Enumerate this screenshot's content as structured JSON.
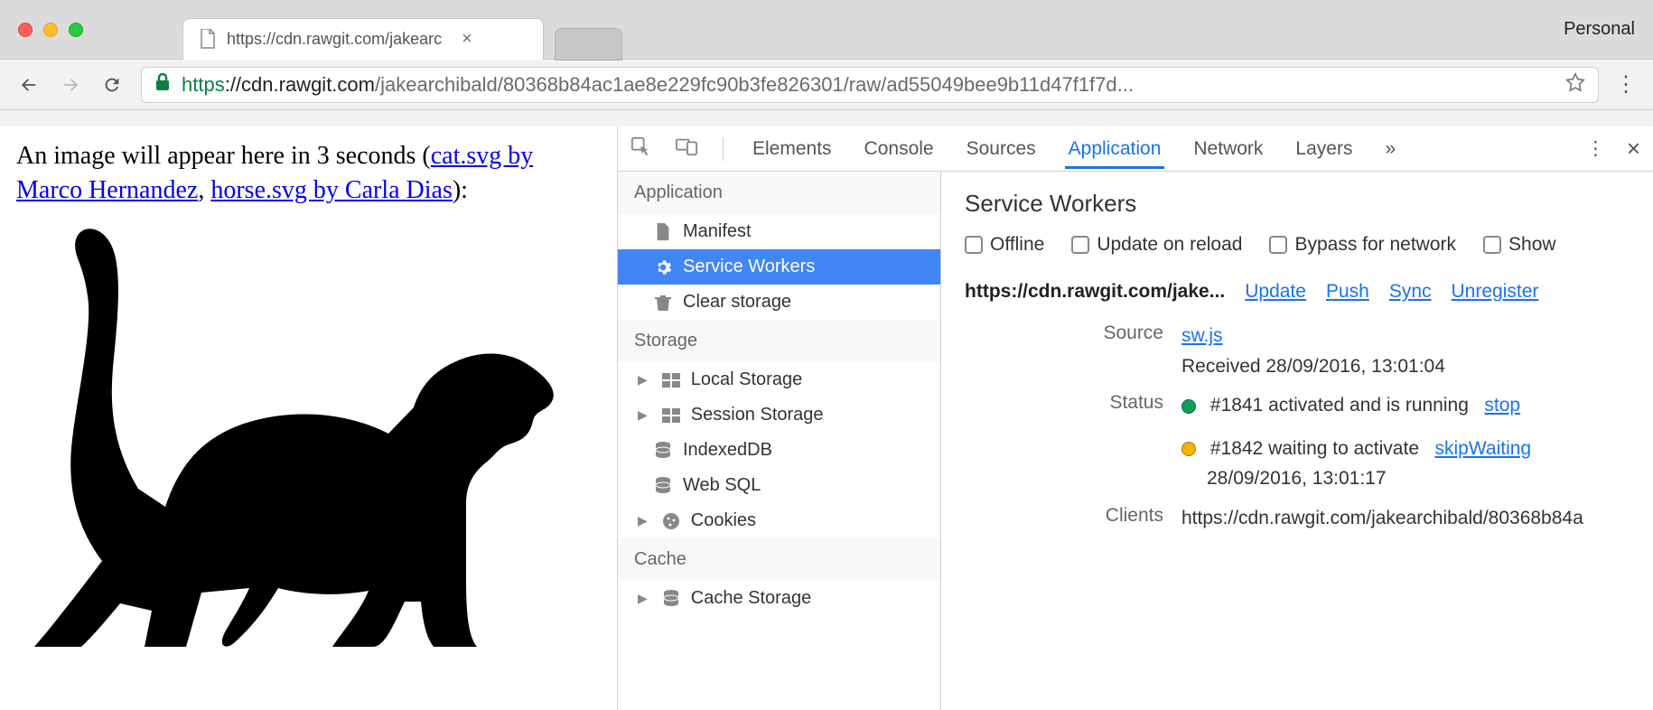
{
  "browser": {
    "tab_url_short": "https://cdn.rawgit.com/jakearc",
    "profile": "Personal",
    "url_scheme": "https",
    "url_host": "://cdn.rawgit.com",
    "url_path": "/jakearchibald/80368b84ac1ae8e229fc90b3fe826301/raw/ad55049bee9b11d47f1f7d..."
  },
  "page": {
    "text_prefix": "An image will appear here in 3 seconds (",
    "link1": "cat.svg by Marco Hernandez",
    "separator": ", ",
    "link2": "horse.svg by Carla Dias",
    "text_suffix": "):"
  },
  "devtools": {
    "tabs": [
      "Elements",
      "Console",
      "Sources",
      "Application",
      "Network",
      "Layers"
    ],
    "active_tab": "Application",
    "overflow": "»"
  },
  "sidebar": {
    "sections": [
      {
        "title": "Application",
        "items": [
          {
            "label": "Manifest",
            "icon": "file"
          },
          {
            "label": "Service Workers",
            "icon": "gear",
            "selected": true
          },
          {
            "label": "Clear storage",
            "icon": "trash"
          }
        ]
      },
      {
        "title": "Storage",
        "items": [
          {
            "label": "Local Storage",
            "icon": "table",
            "expand": true
          },
          {
            "label": "Session Storage",
            "icon": "table",
            "expand": true
          },
          {
            "label": "IndexedDB",
            "icon": "db"
          },
          {
            "label": "Web SQL",
            "icon": "db"
          },
          {
            "label": "Cookies",
            "icon": "cookie",
            "expand": true
          }
        ]
      },
      {
        "title": "Cache",
        "items": [
          {
            "label": "Cache Storage",
            "icon": "db",
            "expand": true
          }
        ]
      }
    ]
  },
  "panel": {
    "title": "Service Workers",
    "checkboxes": [
      "Offline",
      "Update on reload",
      "Bypass for network",
      "Show"
    ],
    "scope": "https://cdn.rawgit.com/jake...",
    "scope_actions": [
      "Update",
      "Push",
      "Sync",
      "Unregister"
    ],
    "source": {
      "label": "Source",
      "file": "sw.js",
      "received": "Received 28/09/2016, 13:01:04"
    },
    "status": {
      "label": "Status",
      "entries": [
        {
          "dot": "green",
          "text": "#1841 activated and is running",
          "action": "stop"
        },
        {
          "dot": "orange",
          "text": "#1842 waiting to activate",
          "action": "skipWaiting",
          "sub": "28/09/2016, 13:01:17"
        }
      ]
    },
    "clients": {
      "label": "Clients",
      "value": "https://cdn.rawgit.com/jakearchibald/80368b84a"
    }
  }
}
